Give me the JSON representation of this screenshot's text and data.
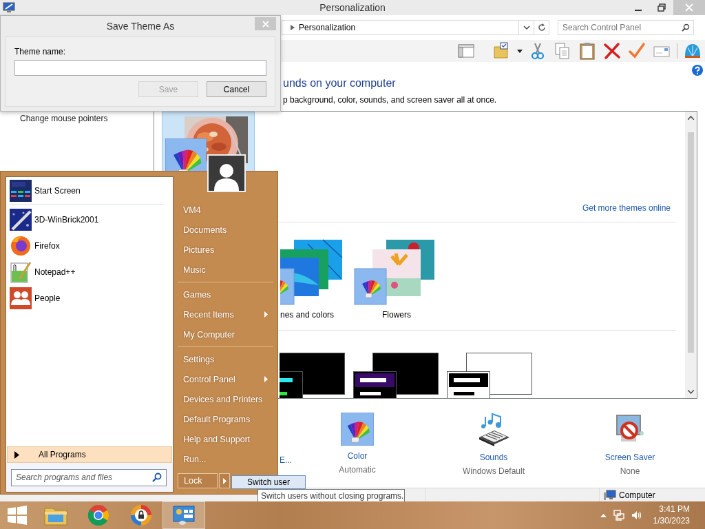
{
  "window": {
    "title": "Personalization",
    "breadcrumb": "Personalization",
    "search": {
      "placeholder": "Search Control Panel"
    },
    "sidebar": {
      "items": [
        "Change mouse pointers"
      ]
    },
    "heading": "unds on your computer",
    "description": "p background, color, sounds, and screen saver all at once.",
    "my_theme": {
      "selected": true
    },
    "themes_link": "Get more themes online",
    "themes": [
      {
        "label": "nes and colors",
        "kind": "lines",
        "selected": false
      },
      {
        "label": "Flowers",
        "kind": "flowers",
        "selected": false
      }
    ],
    "high_contrast": [
      {
        "kind": "teal"
      },
      {
        "kind": "purple"
      },
      {
        "kind": "white"
      }
    ],
    "settings": [
      {
        "kind": "background",
        "label": "E..."
      },
      {
        "kind": "color",
        "label": "Color",
        "value": "Automatic"
      },
      {
        "kind": "sounds",
        "label": "Sounds",
        "value": "Windows Default"
      },
      {
        "kind": "screen-saver",
        "label": "Screen Saver",
        "value": "None"
      }
    ],
    "status_bar": {
      "location": "Computer"
    }
  },
  "dialog": {
    "title": "Save Theme As",
    "field_label": "Theme name:",
    "buttons": [
      {
        "label": "Save",
        "disabled": true
      },
      {
        "label": "Cancel",
        "disabled": false
      }
    ]
  },
  "start_menu": {
    "programs": [
      {
        "label": "Start Screen",
        "kind": "start-screen"
      },
      {
        "label": "3D-WinBrick2001",
        "kind": "winbrick"
      },
      {
        "label": "Firefox",
        "kind": "firefox"
      },
      {
        "label": "Notepad++",
        "kind": "notepad"
      },
      {
        "label": "People",
        "kind": "people"
      }
    ],
    "all_programs": "All Programs",
    "search": {
      "placeholder": "Search programs and files"
    },
    "places": [
      {
        "items": [
          {
            "label": "VM4",
            "submenu": false
          },
          {
            "label": "Documents",
            "submenu": false
          },
          {
            "label": "Pictures",
            "submenu": false
          },
          {
            "label": "Music",
            "submenu": false
          }
        ]
      },
      {
        "items": [
          {
            "label": "Games",
            "submenu": false
          },
          {
            "label": "Recent Items",
            "submenu": true
          },
          {
            "label": "My Computer",
            "submenu": false
          }
        ]
      },
      {
        "items": [
          {
            "label": "Settings",
            "submenu": false
          },
          {
            "label": "Control Panel",
            "submenu": true
          },
          {
            "label": "Devices and Printers",
            "submenu": false
          },
          {
            "label": "Default Programs",
            "submenu": false
          },
          {
            "label": "Help and Support",
            "submenu": false
          },
          {
            "label": "Run...",
            "submenu": false
          }
        ]
      }
    ],
    "lock": "Lock",
    "submenu": [
      {
        "label": "Switch user",
        "selected": true
      }
    ],
    "tooltip": "Switch users without closing programs."
  },
  "taskbar": {
    "apps": [
      {
        "kind": "folder",
        "selected": false
      },
      {
        "kind": "chrome",
        "selected": false
      },
      {
        "kind": "lock-browser",
        "selected": false
      },
      {
        "kind": "control-panel",
        "selected": true
      }
    ],
    "time": "3:41 PM",
    "date": "1/30/2023"
  }
}
